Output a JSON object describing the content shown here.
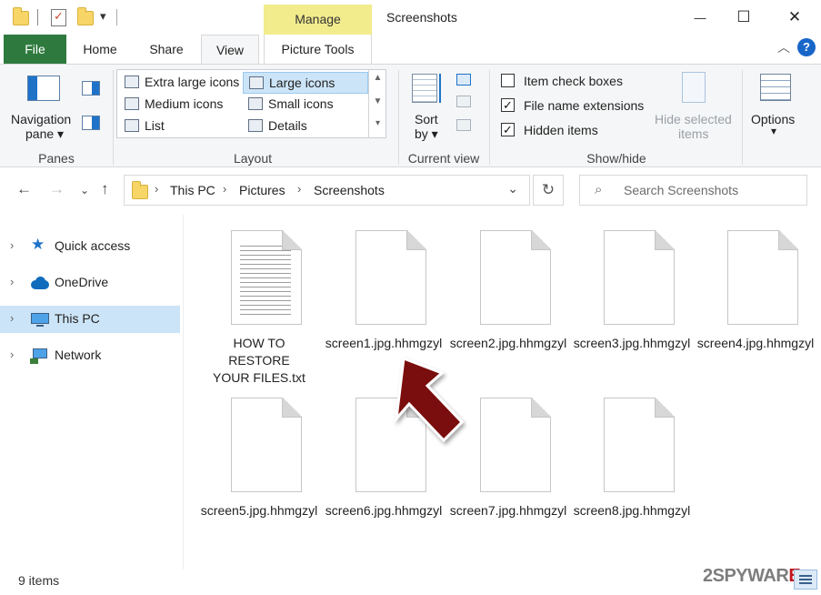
{
  "window": {
    "title": "Screenshots",
    "context_tab": "Manage"
  },
  "quick_access_toolbar": {
    "dropdown": "▾"
  },
  "window_controls": {
    "minimize": "—",
    "maximize": "☐",
    "close": "✕"
  },
  "tabs": {
    "file": "File",
    "home": "Home",
    "share": "Share",
    "view": "View",
    "picture_tools": "Picture Tools"
  },
  "ribbon": {
    "panes": {
      "nav_pane_line1": "Navigation",
      "nav_pane_line2": "pane ▾",
      "label": "Panes"
    },
    "layout": {
      "items": [
        "Extra large icons",
        "Large icons",
        "Medium icons",
        "Small icons",
        "List",
        "Details"
      ],
      "selected": "Large icons",
      "label": "Layout"
    },
    "current_view": {
      "sort_line1": "Sort",
      "sort_line2": "by ▾",
      "label": "Current view"
    },
    "show_hide": {
      "item_check_boxes": "Item check boxes",
      "file_name_extensions": "File name extensions",
      "hidden_items": "Hidden items",
      "hide_selected_line1": "Hide selected",
      "hide_selected_line2": "items",
      "label": "Show/hide",
      "checks": {
        "item_check_boxes": false,
        "file_name_extensions": true,
        "hidden_items": true
      }
    },
    "options": {
      "label_line1": "Options",
      "label_line2": "▾"
    }
  },
  "address_bar": {
    "crumbs": [
      "This PC",
      "Pictures",
      "Screenshots"
    ],
    "search_placeholder": "Search Screenshots"
  },
  "sidebar": {
    "items": [
      "Quick access",
      "OneDrive",
      "This PC",
      "Network"
    ],
    "selected": "This PC"
  },
  "files": [
    {
      "name": "HOW TO RESTORE YOUR FILES.txt",
      "type": "txt"
    },
    {
      "name": "screen1.jpg.hhmgzyl",
      "type": "blank"
    },
    {
      "name": "screen2.jpg.hhmgzyl",
      "type": "blank"
    },
    {
      "name": "screen3.jpg.hhmgzyl",
      "type": "blank"
    },
    {
      "name": "screen4.jpg.hhmgzyl",
      "type": "blank"
    },
    {
      "name": "screen5.jpg.hhmgzyl",
      "type": "blank"
    },
    {
      "name": "screen6.jpg.hhmgzyl",
      "type": "blank"
    },
    {
      "name": "screen7.jpg.hhmgzyl",
      "type": "blank"
    },
    {
      "name": "screen8.jpg.hhmgzyl",
      "type": "blank"
    }
  ],
  "status_bar": {
    "item_count": "9 items"
  },
  "watermark": {
    "prefix": "2SPYWAR",
    "suffix": "E"
  },
  "colors": {
    "file_tab": "#2e7a3e",
    "manage_tab": "#f2ec8d",
    "selection": "#cce4f7",
    "help": "#1966c9",
    "arrow": "#7a0a0a"
  },
  "icons": [
    "folder-icon",
    "properties-icon",
    "search-icon",
    "refresh-icon",
    "back-arrow-icon",
    "forward-arrow-icon",
    "up-arrow-icon",
    "star-icon",
    "cloud-icon",
    "computer-icon",
    "network-icon",
    "help-icon"
  ]
}
